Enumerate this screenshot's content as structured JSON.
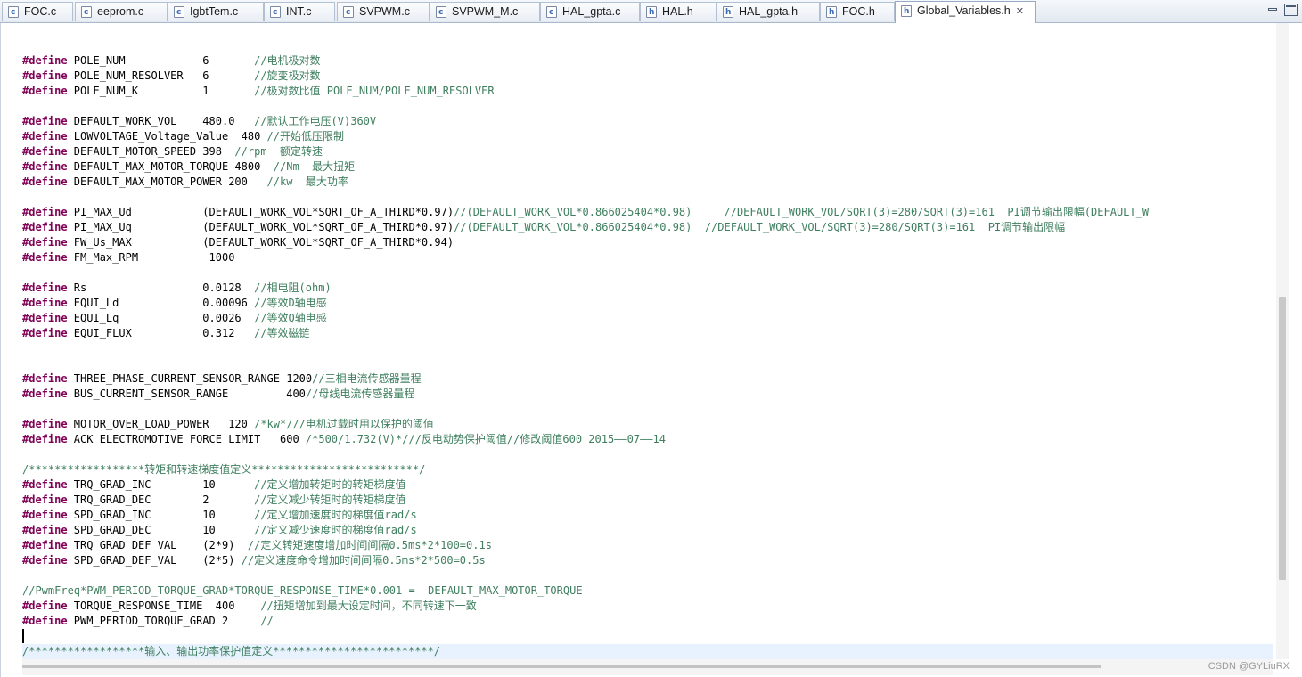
{
  "tabs": [
    {
      "label": "FOC.c",
      "icon": "c-file-icon",
      "active": false
    },
    {
      "label": "eeprom.c",
      "icon": "c-file-icon",
      "active": false
    },
    {
      "label": "IgbtTem.c",
      "icon": "c-file-icon",
      "active": false
    },
    {
      "label": "INT.c",
      "icon": "c-file-icon",
      "active": false
    },
    {
      "label": "SVPWM.c",
      "icon": "c-file-icon",
      "active": false
    },
    {
      "label": "SVPWM_M.c",
      "icon": "c-file-icon",
      "active": false
    },
    {
      "label": "HAL_gpta.c",
      "icon": "c-file-icon",
      "active": false
    },
    {
      "label": "HAL.h",
      "icon": "h-file-icon",
      "active": false
    },
    {
      "label": "HAL_gpta.h",
      "icon": "h-file-icon",
      "active": false
    },
    {
      "label": "FOC.h",
      "icon": "h-file-icon",
      "active": false
    },
    {
      "label": "Global_Variables.h",
      "icon": "h-file-icon",
      "active": true
    }
  ],
  "window_controls": {
    "minimize": "minimize-icon",
    "maximize": "maximize-icon"
  },
  "colors": {
    "keyword": "#7f0055",
    "comment": "#3f7f5f",
    "current_line": "#e8f2fe"
  },
  "code_lines": [
    [
      {
        "t": "#define",
        "k": "kw"
      },
      {
        "t": " POLE_NUM            6       "
      },
      {
        "t": "//电机极对数",
        "k": "cm"
      }
    ],
    [
      {
        "t": "#define",
        "k": "kw"
      },
      {
        "t": " POLE_NUM_RESOLVER   6       "
      },
      {
        "t": "//旋变极对数",
        "k": "cm"
      }
    ],
    [
      {
        "t": "#define",
        "k": "kw"
      },
      {
        "t": " POLE_NUM_K          1       "
      },
      {
        "t": "//极对数比值 POLE_NUM/POLE_NUM_RESOLVER",
        "k": "cm"
      }
    ],
    [],
    [
      {
        "t": "#define",
        "k": "kw"
      },
      {
        "t": " DEFAULT_WORK_VOL    480.0   "
      },
      {
        "t": "//默认工作电压(V)360V",
        "k": "cm"
      }
    ],
    [
      {
        "t": "#define",
        "k": "kw"
      },
      {
        "t": " LOWVOLTAGE_Voltage_Value  480 "
      },
      {
        "t": "//开始低压限制",
        "k": "cm"
      }
    ],
    [
      {
        "t": "#define",
        "k": "kw"
      },
      {
        "t": " DEFAULT_MOTOR_SPEED 398  "
      },
      {
        "t": "//rpm  额定转速",
        "k": "cm"
      }
    ],
    [
      {
        "t": "#define",
        "k": "kw"
      },
      {
        "t": " DEFAULT_MAX_MOTOR_TORQUE 4800  "
      },
      {
        "t": "//Nm  最大扭矩",
        "k": "cm"
      }
    ],
    [
      {
        "t": "#define",
        "k": "kw"
      },
      {
        "t": " DEFAULT_MAX_MOTOR_POWER 200   "
      },
      {
        "t": "//kw  最大功率",
        "k": "cm"
      }
    ],
    [],
    [
      {
        "t": "#define",
        "k": "kw"
      },
      {
        "t": " PI_MAX_Ud           (DEFAULT_WORK_VOL*SQRT_OF_A_THIRD*0.97)"
      },
      {
        "t": "//(DEFAULT_WORK_VOL*0.866025404*0.98)     //DEFAULT_WORK_VOL/SQRT(3)=280/SQRT(3)=161  PI调节输出限幅(DEFAULT_W",
        "k": "cm"
      }
    ],
    [
      {
        "t": "#define",
        "k": "kw"
      },
      {
        "t": " PI_MAX_Uq           (DEFAULT_WORK_VOL*SQRT_OF_A_THIRD*0.97)"
      },
      {
        "t": "//(DEFAULT_WORK_VOL*0.866025404*0.98)  //DEFAULT_WORK_VOL/SQRT(3)=280/SQRT(3)=161  PI调节输出限幅",
        "k": "cm"
      }
    ],
    [
      {
        "t": "#define",
        "k": "kw"
      },
      {
        "t": " FW_Us_MAX           (DEFAULT_WORK_VOL*SQRT_OF_A_THIRD*0.94)"
      }
    ],
    [
      {
        "t": "#define",
        "k": "kw"
      },
      {
        "t": " FM_Max_RPM           1000"
      }
    ],
    [],
    [
      {
        "t": "#define",
        "k": "kw"
      },
      {
        "t": " Rs                  0.0128  "
      },
      {
        "t": "//相电阻(ohm)",
        "k": "cm"
      }
    ],
    [
      {
        "t": "#define",
        "k": "kw"
      },
      {
        "t": " EQUI_Ld             0.00096 "
      },
      {
        "t": "//等效D轴电感",
        "k": "cm"
      }
    ],
    [
      {
        "t": "#define",
        "k": "kw"
      },
      {
        "t": " EQUI_Lq             0.0026  "
      },
      {
        "t": "//等效Q轴电感",
        "k": "cm"
      }
    ],
    [
      {
        "t": "#define",
        "k": "kw"
      },
      {
        "t": " EQUI_FLUX           0.312   "
      },
      {
        "t": "//等效磁链",
        "k": "cm"
      }
    ],
    [],
    [],
    [
      {
        "t": "#define",
        "k": "kw"
      },
      {
        "t": " THREE_PHASE_CURRENT_SENSOR_RANGE 1200"
      },
      {
        "t": "//三相电流传感器量程",
        "k": "cm"
      }
    ],
    [
      {
        "t": "#define",
        "k": "kw"
      },
      {
        "t": " BUS_CURRENT_SENSOR_RANGE         400"
      },
      {
        "t": "//母线电流传感器量程",
        "k": "cm"
      }
    ],
    [],
    [
      {
        "t": "#define",
        "k": "kw"
      },
      {
        "t": " MOTOR_OVER_LOAD_POWER   120 "
      },
      {
        "t": "/*kw*///电机过载时用以保护的阈值",
        "k": "cm"
      }
    ],
    [
      {
        "t": "#define",
        "k": "kw"
      },
      {
        "t": " ACK_ELECTROMOTIVE_FORCE_LIMIT   600 "
      },
      {
        "t": "/*500/1.732(V)*///反电动势保护阈值//修改阈值600 2015——07——14",
        "k": "cm"
      }
    ],
    [],
    [
      {
        "t": "/******************转矩和转速梯度值定义**************************/",
        "k": "cm"
      }
    ],
    [
      {
        "t": "#define",
        "k": "kw"
      },
      {
        "t": " TRQ_GRAD_INC        10      "
      },
      {
        "t": "//定义增加转矩时的转矩梯度值",
        "k": "cm"
      }
    ],
    [
      {
        "t": "#define",
        "k": "kw"
      },
      {
        "t": " TRQ_GRAD_DEC        2       "
      },
      {
        "t": "//定义减少转矩时的转矩梯度值",
        "k": "cm"
      }
    ],
    [
      {
        "t": "#define",
        "k": "kw"
      },
      {
        "t": " SPD_GRAD_INC        10      "
      },
      {
        "t": "//定义增加速度时的梯度值rad/s",
        "k": "cm"
      }
    ],
    [
      {
        "t": "#define",
        "k": "kw"
      },
      {
        "t": " SPD_GRAD_DEC        10      "
      },
      {
        "t": "//定义减少速度时的梯度值rad/s",
        "k": "cm"
      }
    ],
    [
      {
        "t": "#define",
        "k": "kw"
      },
      {
        "t": " TRQ_GRAD_DEF_VAL    (2*9)  "
      },
      {
        "t": "//定义转矩速度增加时间间隔0.5ms*2*100=0.1s",
        "k": "cm"
      }
    ],
    [
      {
        "t": "#define",
        "k": "kw"
      },
      {
        "t": " SPD_GRAD_DEF_VAL    (2*5) "
      },
      {
        "t": "//定义速度命令增加时间间隔0.5ms*2*500=0.5s",
        "k": "cm"
      }
    ],
    [],
    [
      {
        "t": "//PwmFreq*PWM_PERIOD_TORQUE_GRAD*TORQUE_RESPONSE_TIME*0.001 =  DEFAULT_MAX_MOTOR_TORQUE",
        "k": "cm"
      }
    ],
    [
      {
        "t": "#define",
        "k": "kw"
      },
      {
        "t": " TORQUE_RESPONSE_TIME  400    "
      },
      {
        "t": "//扭矩增加到最大设定时间，不同转速下一致",
        "k": "cm"
      }
    ],
    [
      {
        "t": "#define",
        "k": "kw"
      },
      {
        "t": " PWM_PERIOD_TORQUE_GRAD 2     "
      },
      {
        "t": "//",
        "k": "cm"
      }
    ],
    [],
    [
      {
        "t": "/******************输入、输出功率保护值定义*************************/",
        "k": "cm"
      }
    ]
  ],
  "current_line_index": 39,
  "watermark": "CSDN @GYLiuRX"
}
